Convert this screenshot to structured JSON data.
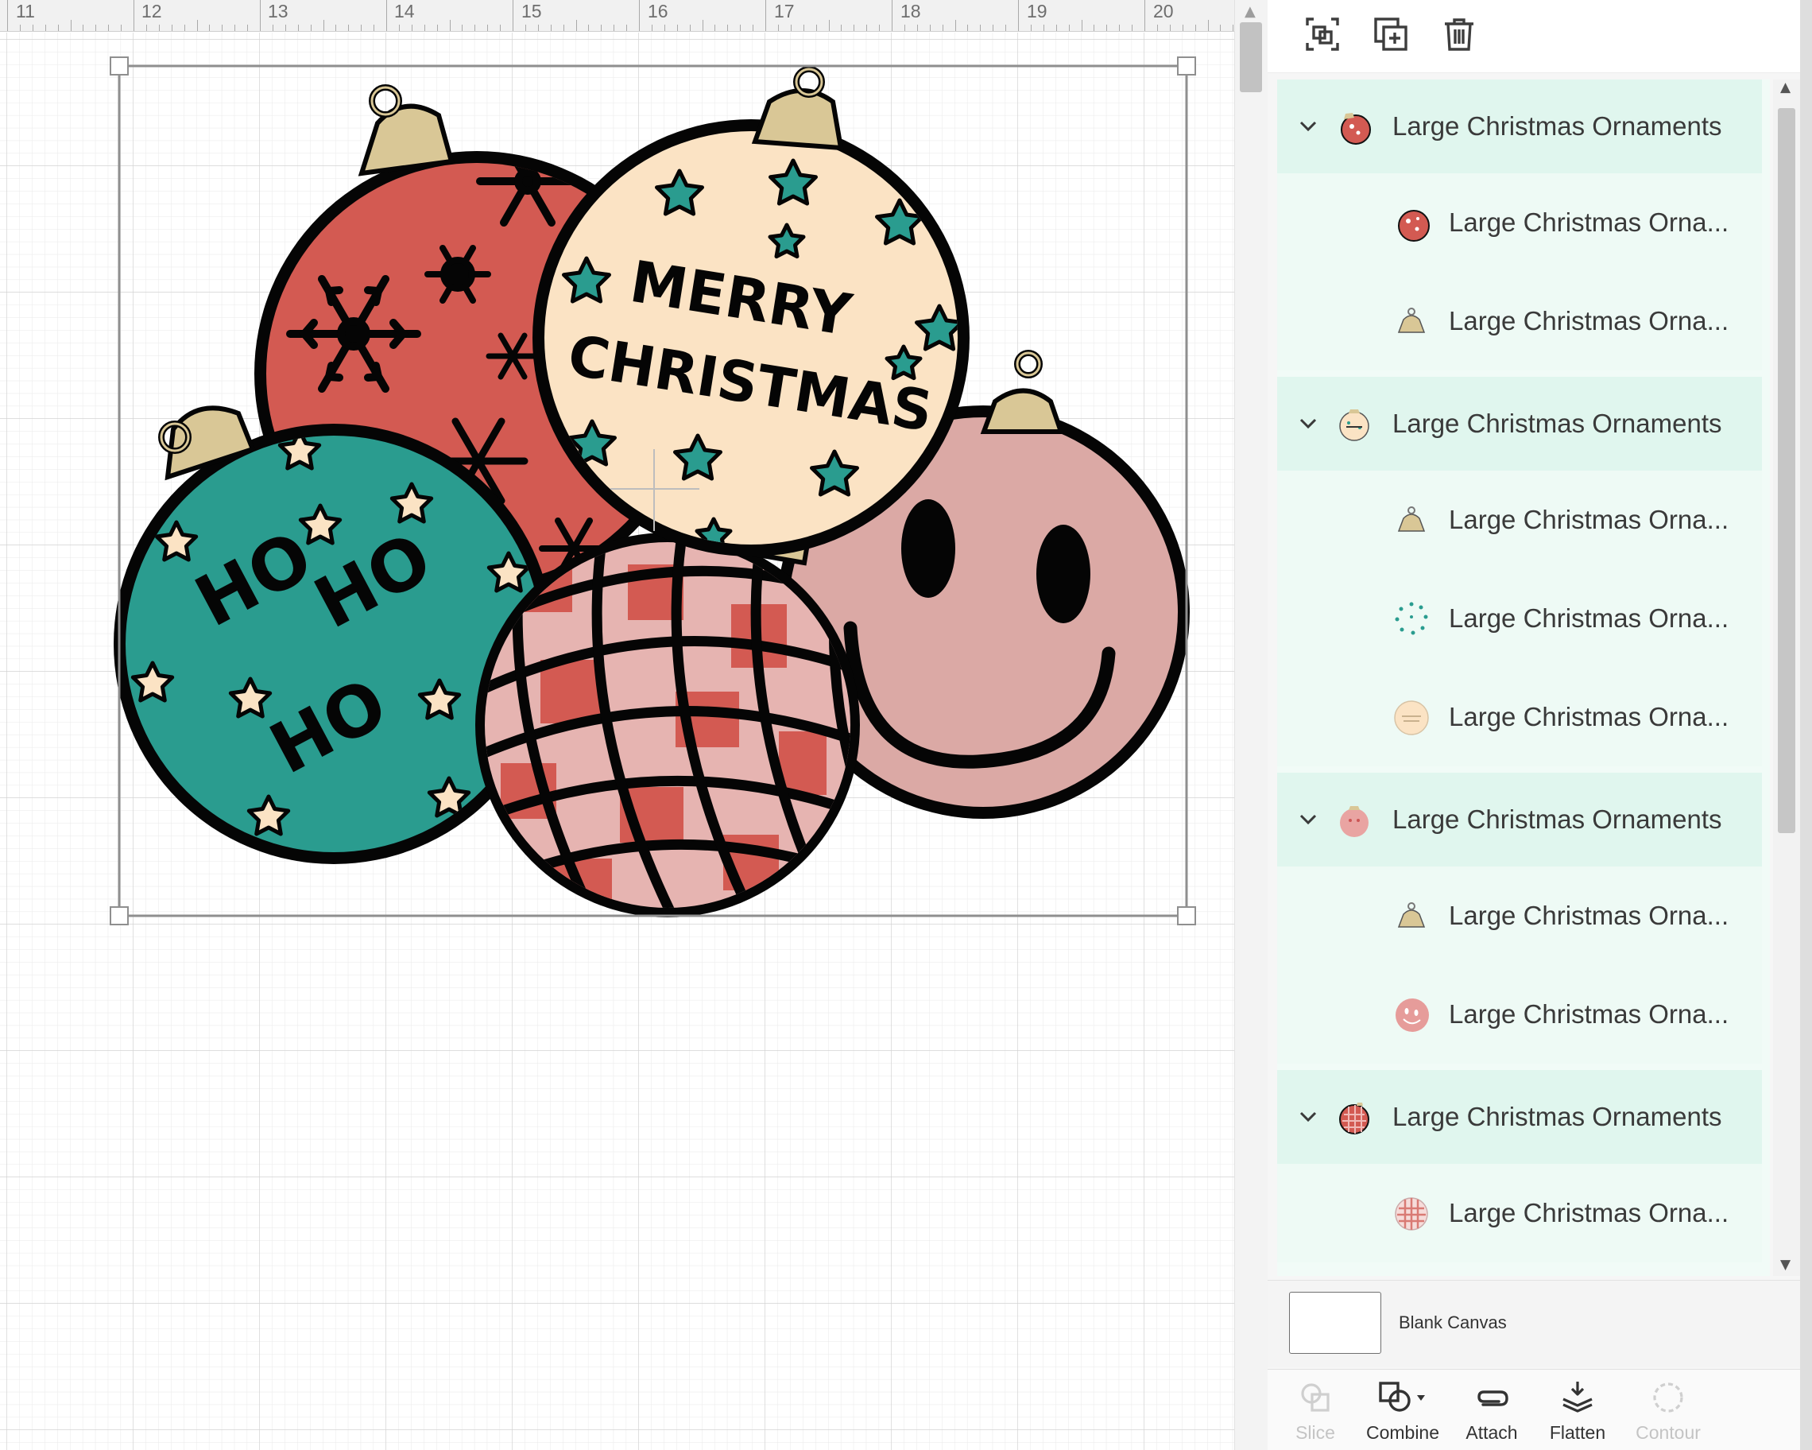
{
  "ruler": {
    "labels": [
      "11",
      "12",
      "13",
      "14",
      "15",
      "16",
      "17",
      "18",
      "19",
      "20"
    ]
  },
  "design": {
    "merry_line1": "MERRY",
    "merry_line2": "CHRISTMAS",
    "ho_text": "HO"
  },
  "toolbar": {
    "group_icon": "group-icon",
    "duplicate_icon": "duplicate-icon",
    "delete_icon": "trash-icon"
  },
  "layers": {
    "groups": [
      {
        "label": "Large Christmas Ornaments",
        "children": [
          "Large Christmas Orna...",
          "Large Christmas Orna..."
        ]
      },
      {
        "label": "Large Christmas Ornaments",
        "children": [
          "Large Christmas Orna...",
          "Large Christmas Orna...",
          "Large Christmas Orna..."
        ]
      },
      {
        "label": "Large Christmas Ornaments",
        "children": [
          "Large Christmas Orna...",
          "Large Christmas Orna..."
        ]
      },
      {
        "label": "Large Christmas Ornaments",
        "children": [
          "Large Christmas Orna..."
        ]
      }
    ]
  },
  "canvas": {
    "blank_label": "Blank Canvas"
  },
  "actions": [
    {
      "label": "Slice",
      "enabled": false
    },
    {
      "label": "Combine",
      "enabled": true
    },
    {
      "label": "Attach",
      "enabled": true
    },
    {
      "label": "Flatten",
      "enabled": true
    },
    {
      "label": "Contour",
      "enabled": false
    }
  ],
  "colors": {
    "red": "#d35a52",
    "cream": "#fbe3c4",
    "teal": "#2a9c8f",
    "pink": "#dba9a5",
    "gold": "#d9c796",
    "ink": "#050505",
    "panel_mint": "#e0f6ee"
  }
}
